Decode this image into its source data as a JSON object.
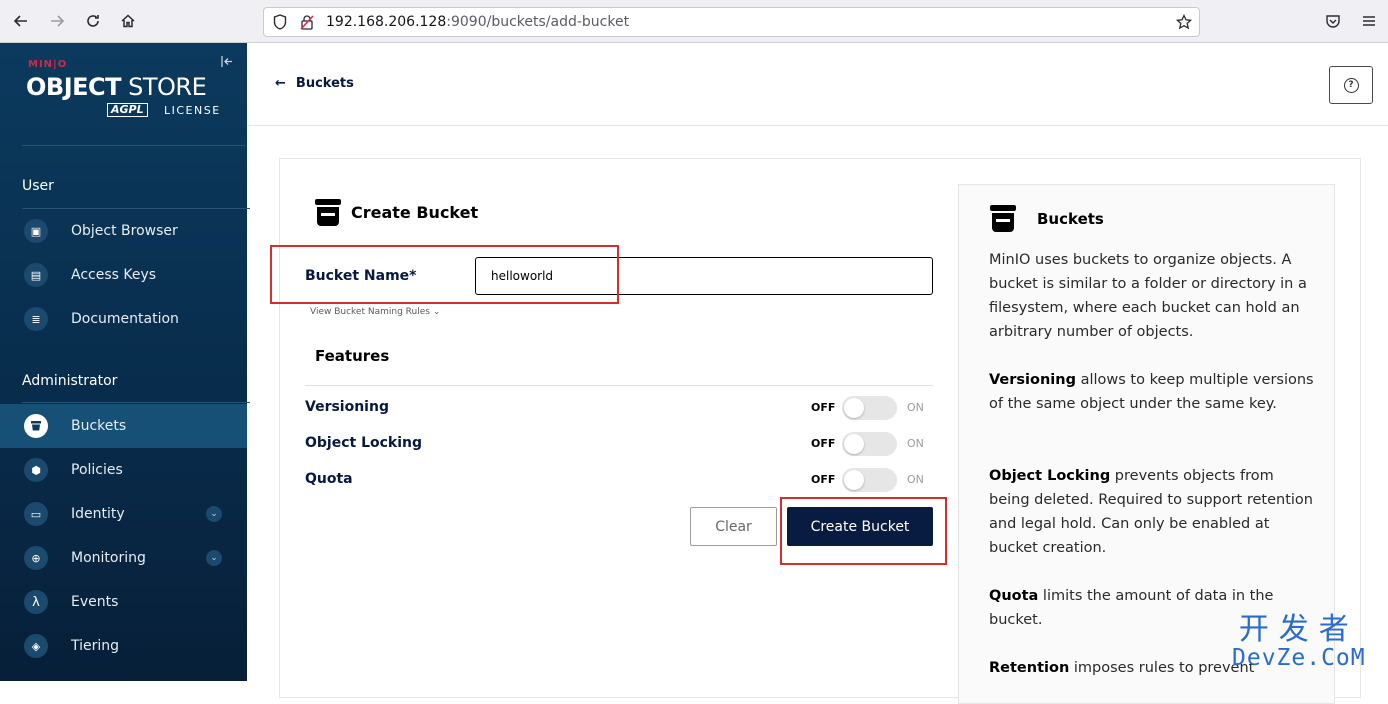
{
  "browser": {
    "url_host": "192.168.206.128",
    "url_rest": ":9090/buckets/add-bucket"
  },
  "sidebar": {
    "logo_brand": "MIN|O",
    "logo_title_a": "OBJECT",
    "logo_title_b": " STORE",
    "logo_badge": "AGPL",
    "logo_license": "LICENSE",
    "user_section": "User",
    "user_items": [
      {
        "label": "Object Browser",
        "icon": "object-browser-icon"
      },
      {
        "label": "Access Keys",
        "icon": "access-keys-icon"
      },
      {
        "label": "Documentation",
        "icon": "documentation-icon"
      }
    ],
    "admin_section": "Administrator",
    "admin_items": [
      {
        "label": "Buckets",
        "icon": "bucket-icon",
        "active": true
      },
      {
        "label": "Policies",
        "icon": "policies-icon"
      },
      {
        "label": "Identity",
        "icon": "identity-icon",
        "expandable": true
      },
      {
        "label": "Monitoring",
        "icon": "monitoring-icon",
        "expandable": true
      },
      {
        "label": "Events",
        "icon": "lambda-icon"
      },
      {
        "label": "Tiering",
        "icon": "tiering-icon"
      }
    ]
  },
  "header": {
    "back_label": "Buckets"
  },
  "form": {
    "title": "Create Bucket",
    "bucket_name_label": "Bucket Name*",
    "bucket_name_value": "helloworld",
    "naming_rules_link": "View Bucket Naming Rules",
    "features_title": "Features",
    "features": [
      {
        "label": "Versioning",
        "off": "OFF",
        "on": "ON",
        "enabled": false
      },
      {
        "label": "Object Locking",
        "off": "OFF",
        "on": "ON",
        "enabled": false
      },
      {
        "label": "Quota",
        "off": "OFF",
        "on": "ON",
        "enabled": false
      }
    ],
    "clear_label": "Clear",
    "create_label": "Create Bucket"
  },
  "info": {
    "title": "Buckets",
    "intro": "MinIO uses buckets to organize objects. A bucket is similar to a folder or directory in a filesystem, where each bucket can hold an arbitrary number of objects.",
    "versioning_term": "Versioning",
    "versioning_text": " allows to keep multiple versions of the same object under the same key.",
    "locking_term": "Object Locking",
    "locking_text": " prevents objects from being deleted. Required to support retention and legal hold. Can only be enabled at bucket creation.",
    "quota_term": "Quota",
    "quota_text": " limits the amount of data in the bucket.",
    "retention_term": "Retention",
    "retention_text": " imposes rules to prevent"
  },
  "watermark": {
    "chinese": "开发者",
    "english": "DevZe.CoM"
  },
  "colors": {
    "sidebar_bg": "#0b3a5e",
    "primary_button": "#081c42",
    "highlight": "#d32f2f",
    "watermark": "#2a6bd1"
  }
}
